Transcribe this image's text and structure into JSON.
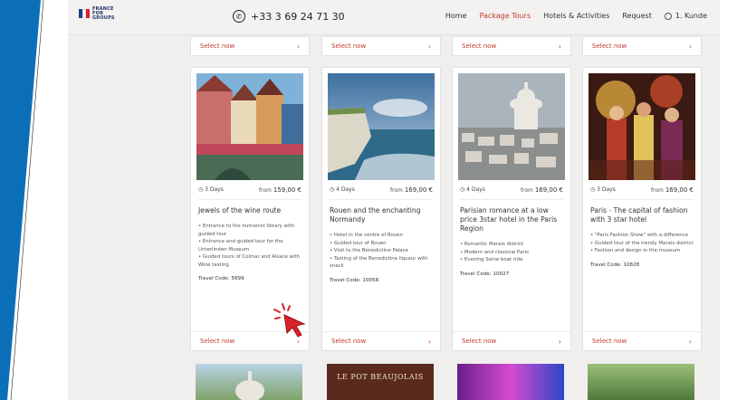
{
  "brand": {
    "logo_text_lines": [
      "FRANCE",
      "FOR",
      "GROUPS"
    ],
    "flag_colors": [
      "#1d3f8c",
      "#ffffff",
      "#d8232a"
    ]
  },
  "header": {
    "phone": "+33 3 69 24 71 30",
    "nav": [
      "Home",
      "Package Tours",
      "Hotels & Activities",
      "Request"
    ],
    "active_nav": "Package Tours",
    "user": "1. Kunde"
  },
  "cards": [
    {
      "duration": "3 Days",
      "from_label": "from",
      "price": "159,00 €",
      "title": "Jewels of the wine route",
      "features": [
        "Entrance to the humanist library with guided tour",
        "Entrance and guided tour for the Unterlinden Museum",
        "Guided tours of Colmar and Alsace with Wine tasting"
      ],
      "code": "Travel Code: 5699",
      "cta": "Select now"
    },
    {
      "duration": "4 Days",
      "from_label": "from",
      "price": "169,00 €",
      "title": "Rouen and the enchanting Normandy",
      "features": [
        "Hotel in the centre of Rouen",
        "Guided tour of Rouen",
        "Visit to the Benedictine Palace",
        "Tasting of the Benedictine liqueur with snack"
      ],
      "code": "Travel Code: 10058",
      "cta": "Select now"
    },
    {
      "duration": "4 Days",
      "from_label": "from",
      "price": "169,00 €",
      "title": "Parisian romance at a low price 3star hotel in the Paris Region",
      "features": [
        "Romantic Marais district",
        "Modern and classical Paris",
        "Evening Seine boat ride"
      ],
      "code": "Travel Code: 10027",
      "cta": "Select now"
    },
    {
      "duration": "3 Days",
      "from_label": "from",
      "price": "169,00 €",
      "title": "Paris - The capital of fashion with 3 star hotel",
      "features": [
        "\"Paris Fashion Show\" with a difference",
        "Guided tour of the trendy Marais district",
        "Fashion and design in the museum"
      ],
      "code": "Travel Code: 10828",
      "cta": "Select now"
    }
  ],
  "top_strip_cta": "Select now",
  "bottom_sign_text": "LE POT BEAUJOLAIS",
  "accent_color": "#c0392b",
  "panel_color": "#0b6fb8"
}
